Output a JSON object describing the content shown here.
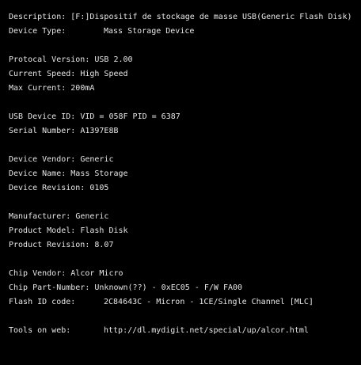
{
  "colors": {
    "background": "#000000",
    "text": "#e6e6e6"
  },
  "report": {
    "description_label": "Description:",
    "description_value": "[F:]Dispositif de stockage de masse USB(Generic Flash Disk)",
    "device_type_label": "Device Type:",
    "device_type_value": "Mass Storage Device",
    "protocal_version_label": "Protocal Version:",
    "protocal_version_value": "USB 2.00",
    "current_speed_label": "Current Speed:",
    "current_speed_value": "High Speed",
    "max_current_label": "Max Current:",
    "max_current_value": "200mA",
    "usb_device_id_label": "USB Device ID:",
    "usb_device_id_value": "VID = 058F PID = 6387",
    "serial_number_label": "Serial Number:",
    "serial_number_value": "A1397E8B",
    "device_vendor_label": "Device Vendor:",
    "device_vendor_value": "Generic",
    "device_name_label": "Device Name:",
    "device_name_value": "Mass Storage",
    "device_revision_label": "Device Revision:",
    "device_revision_value": "0105",
    "manufacturer_label": "Manufacturer:",
    "manufacturer_value": "Generic",
    "product_model_label": "Product Model:",
    "product_model_value": "Flash Disk",
    "product_revision_label": "Product Revision:",
    "product_revision_value": "8.07",
    "chip_vendor_label": "Chip Vendor:",
    "chip_vendor_value": "Alcor Micro",
    "chip_part_number_label": "Chip Part-Number:",
    "chip_part_number_value": "Unknown(??) - 0xEC05 - F/W FA00",
    "flash_id_code_label": "Flash ID code:",
    "flash_id_code_value": "2C84643C - Micron - 1CE/Single Channel [MLC]",
    "tools_on_web_label": "Tools on web:",
    "tools_on_web_value": "http://dl.mydigit.net/special/up/alcor.html"
  }
}
